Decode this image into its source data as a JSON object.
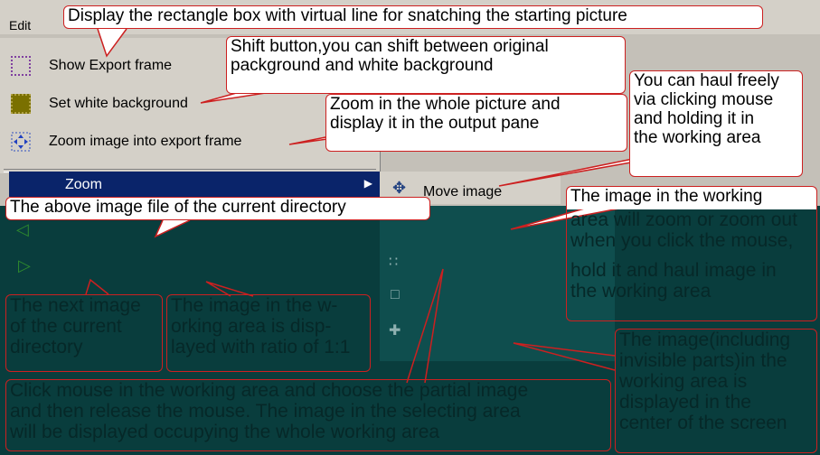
{
  "menu": {
    "edit_label": "Edit",
    "items": [
      {
        "label": "Show Export frame",
        "icon": "export-frame-icon"
      },
      {
        "label": "Set white background",
        "icon": "white-background-icon"
      },
      {
        "label": "Zoom image into export frame",
        "icon": "zoom-export-icon"
      }
    ],
    "zoom_label": "Zoom",
    "submenu_item": "Move image"
  },
  "callouts": {
    "rectangle": "Display the rectangle box with virtual line for snatching the starting picture",
    "shift": [
      "Shift button,you can shift between original",
      "packground and white background"
    ],
    "zoom_whole": [
      "Zoom in the whole picture and",
      "display it in the output pane"
    ],
    "haul": [
      "You can haul freely",
      "via clicking mouse",
      "and  holding it in",
      "the working area"
    ],
    "above_image": "The above image file of the current directory",
    "zoom_click": [
      "The image in the working",
      "area will zoom or zoom out",
      "when you click the mouse,",
      "hold it and  haul image in",
      "the working area"
    ],
    "next_image": [
      "The next image",
      "of  the current",
      "directory"
    ],
    "ratio": [
      "The image in the w-",
      "orking  area  is  disp-",
      "layed with ratio of 1:1"
    ],
    "partial": [
      "Click mouse in the working area and choose the partial image",
      "and then release the mouse. The image in the selecting area",
      "will be displayed occupying the whole working area"
    ],
    "center": [
      "The image(including",
      "invisible  parts)in the",
      "working  area   is",
      "displayed  in  the",
      "center of the screen"
    ]
  },
  "colors": {
    "accent": "#cc2020",
    "work_area": "#093d3d",
    "menu_highlight": "#0a246a"
  }
}
